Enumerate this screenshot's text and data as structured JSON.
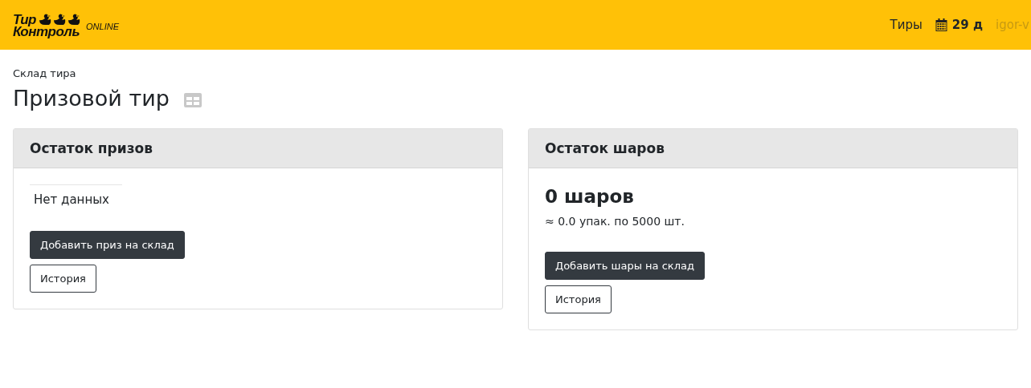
{
  "navbar": {
    "logo": {
      "lines": [
        "Тир",
        "Контроль"
      ],
      "tag": "ONLINE"
    },
    "items": [
      {
        "kind": "link",
        "text": "Тиры"
      },
      {
        "kind": "days",
        "text": "29 д"
      },
      {
        "kind": "user",
        "text": "igor-v"
      }
    ]
  },
  "breadcrumb": "Склад тира",
  "title": "Призовой тир",
  "cards": [
    {
      "title": "Остаток призов",
      "kind": "table",
      "empty_text": "Нет данных",
      "buttons": [
        {
          "kind": "primary",
          "label": "Добавить приз на склад"
        },
        {
          "kind": "outline",
          "label": "История"
        }
      ]
    },
    {
      "title": "Остаток шаров",
      "kind": "stat",
      "value": "0 шаров",
      "note": "≈ 0.0 упак. по 5000 шт.",
      "buttons": [
        {
          "kind": "primary",
          "label": "Добавить шары на склад"
        },
        {
          "kind": "outline",
          "label": "История"
        }
      ]
    }
  ]
}
